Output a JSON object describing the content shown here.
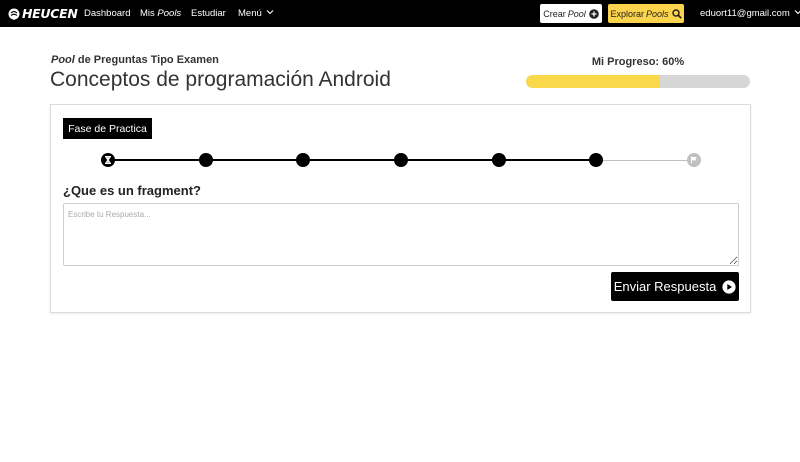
{
  "nav": {
    "brand": "HEUCEN",
    "links": {
      "dashboard": "Dashboard",
      "mis": "Mis",
      "pools": "Pools",
      "estudiar": "Estudiar",
      "menu": "Menú"
    },
    "crear_label": "Crear",
    "crear_pool": "Pool",
    "explorar_label": "Explorar",
    "explorar_pools": "Pools",
    "user_email": "eduort11@gmail.com"
  },
  "header": {
    "subtitle_italic": "Pool",
    "subtitle_rest": " de Preguntas Tipo Examen",
    "title": "Conceptos de programación Android"
  },
  "progress": {
    "label": "Mi Progreso: 60%",
    "value_percent": 60
  },
  "quiz": {
    "phase": "Fase de Practica",
    "steps": [
      "current",
      "done",
      "done",
      "done",
      "done",
      "done",
      "pending"
    ],
    "question": "¿Que es un fragment?",
    "answer_value": "",
    "answer_placeholder": "Escribe tu Respuesta...",
    "submit_label": "Enviar Respuesta"
  },
  "colors": {
    "navbar": "#000000",
    "accent_yellow": "#fcd34d",
    "progress_fill": "#f9d94a",
    "progress_track": "#d6d6d6",
    "step_done": "#000000",
    "step_pending": "#c0c0c0"
  },
  "icons": {
    "brand": "brain-icon",
    "crear": "plus-circle-icon",
    "explorar": "search-icon",
    "step_current": "hourglass-icon",
    "step_final": "flag-icon",
    "submit": "play-circle-icon"
  }
}
